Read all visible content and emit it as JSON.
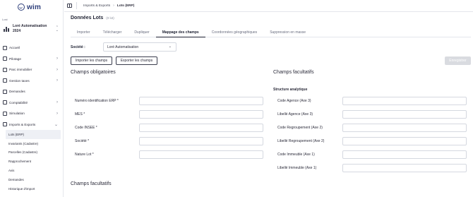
{
  "app": {
    "logo_text": "wim"
  },
  "sidebar": {
    "org_label": "Lost",
    "org_name_line1": "Loré Automatisation",
    "org_name_line2": "2024",
    "items": [
      {
        "label": "Accueil",
        "icon": "home-icon"
      },
      {
        "label": "Pilotage",
        "icon": "chart-icon"
      },
      {
        "label": "Parc immobilier",
        "icon": "building-icon"
      },
      {
        "label": "Gestion taxes",
        "icon": "tax-icon"
      },
      {
        "label": "Demandes",
        "icon": "inbox-icon"
      },
      {
        "label": "Comptabilité",
        "icon": "accounting-icon"
      },
      {
        "label": "Simulation",
        "icon": "simulation-icon"
      },
      {
        "label": "Imports & Exports",
        "icon": "import-export-icon"
      }
    ],
    "sub_items": [
      "Lots (ERP)",
      "Invariants (Cadastre)",
      "Parcelles (Cadastre)",
      "Rapprochement",
      "Avis",
      "Demandes",
      "Historique d'import"
    ]
  },
  "breadcrumb": {
    "parent": "Imports & Exports",
    "current": "Lots (ERP)"
  },
  "page": {
    "title": "Données Lots",
    "count": "(0 lot)"
  },
  "tabs": [
    "Importer",
    "Télécharger",
    "Dupliquer",
    "Mappage des champs",
    "Coordonnées géographiques",
    "Suppression en masse"
  ],
  "active_tab": "Mappage des champs",
  "company": {
    "label": "Société :",
    "value": "Loré Automatisation"
  },
  "buttons": {
    "import": "Importer les champs",
    "export": "Exporter les champs",
    "save": "Enregistrer"
  },
  "left": {
    "title": "Champs obligatoires",
    "fields": [
      "Numéro identification ERP *",
      "MES *",
      "Code INSEE *",
      "Société *",
      "Nature Lot *"
    ]
  },
  "right": {
    "title": "Champs facultatifs",
    "subtitle": "Structure analytique",
    "fields": [
      "Code Agence (Axe 3)",
      "Libellé Agence (Axe 3)",
      "Code Regroupement (Axe 2)",
      "Libellé Regroupement (Axe 2)",
      "Code Immeuble (Axe 1)",
      "Libellé Immeuble (Axe 1)"
    ]
  },
  "bottom_title": "Champs facultatifs",
  "colors": {
    "accent": "#1f2233",
    "brand": "#2d3e7a",
    "save_disabled": "#d9dbe0"
  }
}
